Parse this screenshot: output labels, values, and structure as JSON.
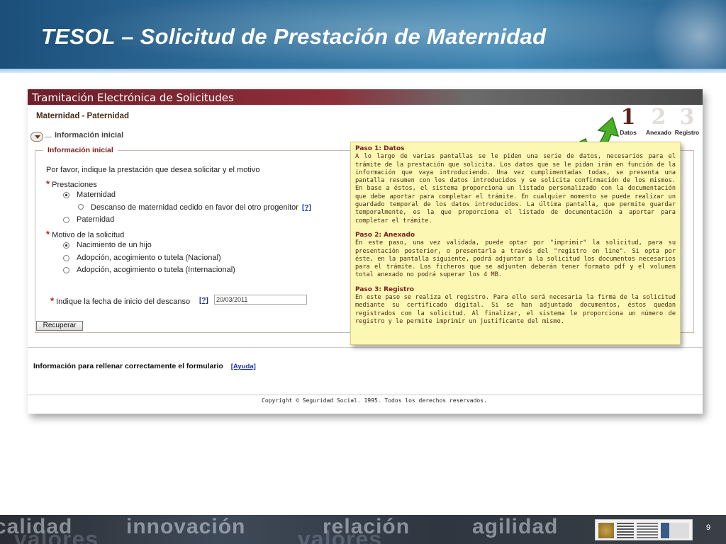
{
  "slide": {
    "title": "TESOL – Solicitud de Prestación de Maternidad",
    "page_number": "9",
    "footer_words": [
      "calidad",
      "innovación",
      "relación",
      "agilidad",
      "valores",
      "valores"
    ]
  },
  "app": {
    "window_title": "Tramitación Electrónica de Solicitudes",
    "section_title": "Maternidad - Paternidad",
    "collapse_label": "Información inicial",
    "fieldset_legend": "Información inicial",
    "prompt": "Por favor, indique la prestación que desea solicitar y el motivo",
    "prestaciones_label": "Prestaciones",
    "prestaciones_options": [
      "Maternidad",
      "Descanso de maternidad cedido en favor del otro progenitor",
      "Paternidad"
    ],
    "help_marker": "[?]",
    "motivo_label": "Motivo de la solicitud",
    "motivo_options": [
      "Nacimiento de un hijo",
      "Adopción, acogimiento o tutela (Nacional)",
      "Adopción, acogimiento o tutela (Internacional)"
    ],
    "fecha_label": "Indique la fecha de inicio del descanso",
    "fecha_value": "20/03/2011",
    "recuperar_button": "Recuperar",
    "info_text": "Información para rellenar correctamente el formulario",
    "ayuda_link": "[Ayuda]",
    "copyright": "Copyright © Seguridad Social. 1995. Todos los derechos reservados."
  },
  "steps": [
    {
      "number": "1",
      "label": "Datos",
      "active": true
    },
    {
      "number": "2",
      "label": "Anexado",
      "active": false
    },
    {
      "number": "3",
      "label": "Registro",
      "active": false
    }
  ],
  "callout": {
    "step1_title": "Paso 1: Datos",
    "step1_text": "A lo largo de varias pantallas se le piden una serie de datos, necesarios para el trámite de la prestación que solicita. Los datos que se le pidan irán en función de la información que vaya introduciendo. Una vez cumplimentadas todas, se presenta una pantalla resumen con los datos introducidos y se solicita confirmación de los mismos. En base a éstos, el sistema proporciona un listado personalizado con la documentación que debe aportar para completar el trámite. En cualquier momento se puede realizar un guardado temporal de los datos introducidos. La última pantalla, que permite guardar temporalmente, es la que proporciona el listado de documentación a aportar para completar el trámite.",
    "step2_title": "Paso 2: Anexado",
    "step2_text": "En este paso, una vez validada, puede optar por \"imprimir\" la solicitud, para su presentación posterior, o presentarla a través del \"registro on line\". Si opta por éste, en la pantalla siguiente, podrá adjuntar a la solicitud los documentos necesarios para el trámite. Los ficheros que se adjunten deberán tener formato pdf y el volumen total anexado no podrá superar los 4 MB.",
    "step3_title": "Paso 3: Registro",
    "step3_text": "En este paso se realiza el registro. Para ello será necesaria la firma de la solicitud mediante su certificado digital. Si se han adjuntado documentos, éstos quedan registrados con la solicitud. Al finalizar, el sistema le proporciona un número de registro y le permite imprimir un justificante del mismo."
  },
  "colors": {
    "header_blue": "#2f6f9b",
    "callout_bg": "#fdf7b4",
    "required_red": "#c41a1a",
    "arrow_green": "#4caf2a"
  }
}
